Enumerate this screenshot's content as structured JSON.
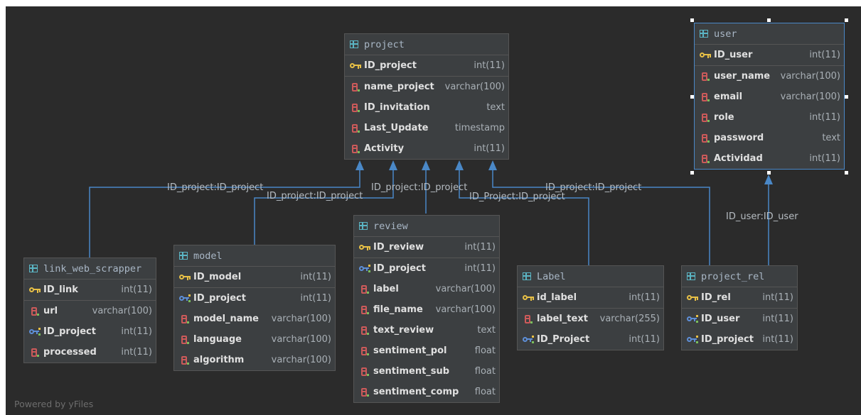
{
  "tables": [
    {
      "id": "project",
      "name": "project",
      "selected": false,
      "fields": [
        {
          "name": "ID_project",
          "type": "int(11)",
          "kind": "pk"
        },
        {
          "name": "name_project",
          "type": "varchar(100)",
          "kind": "col"
        },
        {
          "name": "ID_invitation",
          "type": "text",
          "kind": "col"
        },
        {
          "name": "Last_Update",
          "type": "timestamp",
          "kind": "col"
        },
        {
          "name": "Activity",
          "type": "int(11)",
          "kind": "col"
        }
      ]
    },
    {
      "id": "user",
      "name": "user",
      "selected": true,
      "fields": [
        {
          "name": "ID_user",
          "type": "int(11)",
          "kind": "pk"
        },
        {
          "name": "user_name",
          "type": "varchar(100)",
          "kind": "col"
        },
        {
          "name": "email",
          "type": "varchar(100)",
          "kind": "col"
        },
        {
          "name": "role",
          "type": "int(11)",
          "kind": "col"
        },
        {
          "name": "password",
          "type": "text",
          "kind": "col"
        },
        {
          "name": "Actividad",
          "type": "int(11)",
          "kind": "col"
        }
      ]
    },
    {
      "id": "link_web_scrapper",
      "name": "link_web_scrapper",
      "selected": false,
      "fields": [
        {
          "name": "ID_link",
          "type": "int(11)",
          "kind": "pk"
        },
        {
          "name": "url",
          "type": "varchar(100)",
          "kind": "col"
        },
        {
          "name": "ID_project",
          "type": "int(11)",
          "kind": "fk"
        },
        {
          "name": "processed",
          "type": "int(11)",
          "kind": "col"
        }
      ]
    },
    {
      "id": "model",
      "name": "model",
      "selected": false,
      "fields": [
        {
          "name": "ID_model",
          "type": "int(11)",
          "kind": "pk"
        },
        {
          "name": "ID_project",
          "type": "int(11)",
          "kind": "fk"
        },
        {
          "name": "model_name",
          "type": "varchar(100)",
          "kind": "col"
        },
        {
          "name": "language",
          "type": "varchar(100)",
          "kind": "col"
        },
        {
          "name": "algorithm",
          "type": "varchar(100)",
          "kind": "col"
        }
      ]
    },
    {
      "id": "review",
      "name": "review",
      "selected": false,
      "fields": [
        {
          "name": "ID_review",
          "type": "int(11)",
          "kind": "pk"
        },
        {
          "name": "ID_project",
          "type": "int(11)",
          "kind": "fk"
        },
        {
          "name": "label",
          "type": "varchar(100)",
          "kind": "col"
        },
        {
          "name": "file_name",
          "type": "varchar(100)",
          "kind": "col"
        },
        {
          "name": "text_review",
          "type": "text",
          "kind": "col"
        },
        {
          "name": "sentiment_pol",
          "type": "float",
          "kind": "col"
        },
        {
          "name": "sentiment_sub",
          "type": "float",
          "kind": "col"
        },
        {
          "name": "sentiment_comp",
          "type": "float",
          "kind": "col"
        }
      ]
    },
    {
      "id": "Label",
      "name": "Label",
      "selected": false,
      "fields": [
        {
          "name": "id_label",
          "type": "int(11)",
          "kind": "pk"
        },
        {
          "name": "label_text",
          "type": "varchar(255)",
          "kind": "col"
        },
        {
          "name": "ID_Project",
          "type": "int(11)",
          "kind": "fk"
        }
      ]
    },
    {
      "id": "project_rel",
      "name": "project_rel",
      "selected": false,
      "fields": [
        {
          "name": "ID_rel",
          "type": "int(11)",
          "kind": "pk"
        },
        {
          "name": "ID_user",
          "type": "int(11)",
          "kind": "fk"
        },
        {
          "name": "ID_project",
          "type": "int(11)",
          "kind": "fk"
        }
      ]
    }
  ],
  "edges": [
    {
      "label": "ID_project:ID_project"
    },
    {
      "label": "ID_project:ID_project"
    },
    {
      "label": "ID_project:ID_project"
    },
    {
      "label": "ID_Project:ID_project"
    },
    {
      "label": "ID_project:ID_project"
    },
    {
      "label": "ID_user:ID_user"
    }
  ],
  "footer": "Powered by yFiles",
  "colors": {
    "background": "#2b2b2b",
    "edge": "#4a88c7",
    "table": "#3c3f41"
  }
}
